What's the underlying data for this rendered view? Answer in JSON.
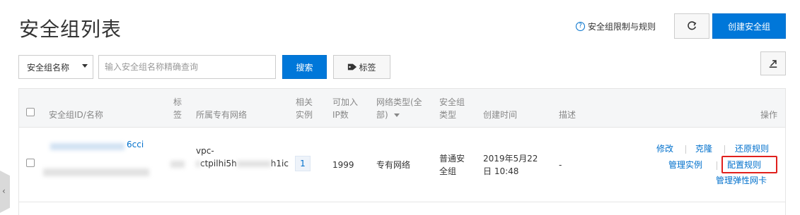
{
  "header": {
    "title": "安全组列表",
    "help_link": "安全组限制与规则",
    "create_button": "创建安全组"
  },
  "toolbar": {
    "filter_select": "安全组名称",
    "search_placeholder": "输入安全组名称精确查询",
    "search_button": "搜索",
    "tag_button": "标签"
  },
  "table": {
    "headers": {
      "id_name": "安全组ID/名称",
      "tag_line1": "标",
      "tag_line2": "签",
      "vpc": "所属专有网络",
      "instances_line1": "相关",
      "instances_line2": "实例",
      "ip_line1": "可加入",
      "ip_line2": "IP数",
      "network_line1": "网络类型(全",
      "network_line2": "部)",
      "type_line1": "安全组",
      "type_line2": "类型",
      "created": "创建时间",
      "description": "描述",
      "actions": "操作"
    },
    "row": {
      "id_visible": "6cci",
      "vpc_line1": "vpc-",
      "vpc_line2_a": "ctpilhi5h",
      "vpc_line2_b": "h1ic",
      "instances": "1",
      "ip_count": "1999",
      "network_type": "专有网络",
      "type_line1": "普通安",
      "type_line2": "全组",
      "created_line1": "2019年5月22",
      "created_line2": "日 10:48",
      "description": "-",
      "actions": {
        "modify": "修改",
        "clone": "克隆",
        "restore_rules": "还原规则",
        "manage_instances": "管理实例",
        "configure_rules": "配置规则",
        "manage_eni": "管理弹性网卡"
      }
    }
  },
  "side_tab_glyph": "‹",
  "colors": {
    "primary": "#0077d9",
    "link": "#0070cc",
    "highlight": "#e0201d"
  }
}
